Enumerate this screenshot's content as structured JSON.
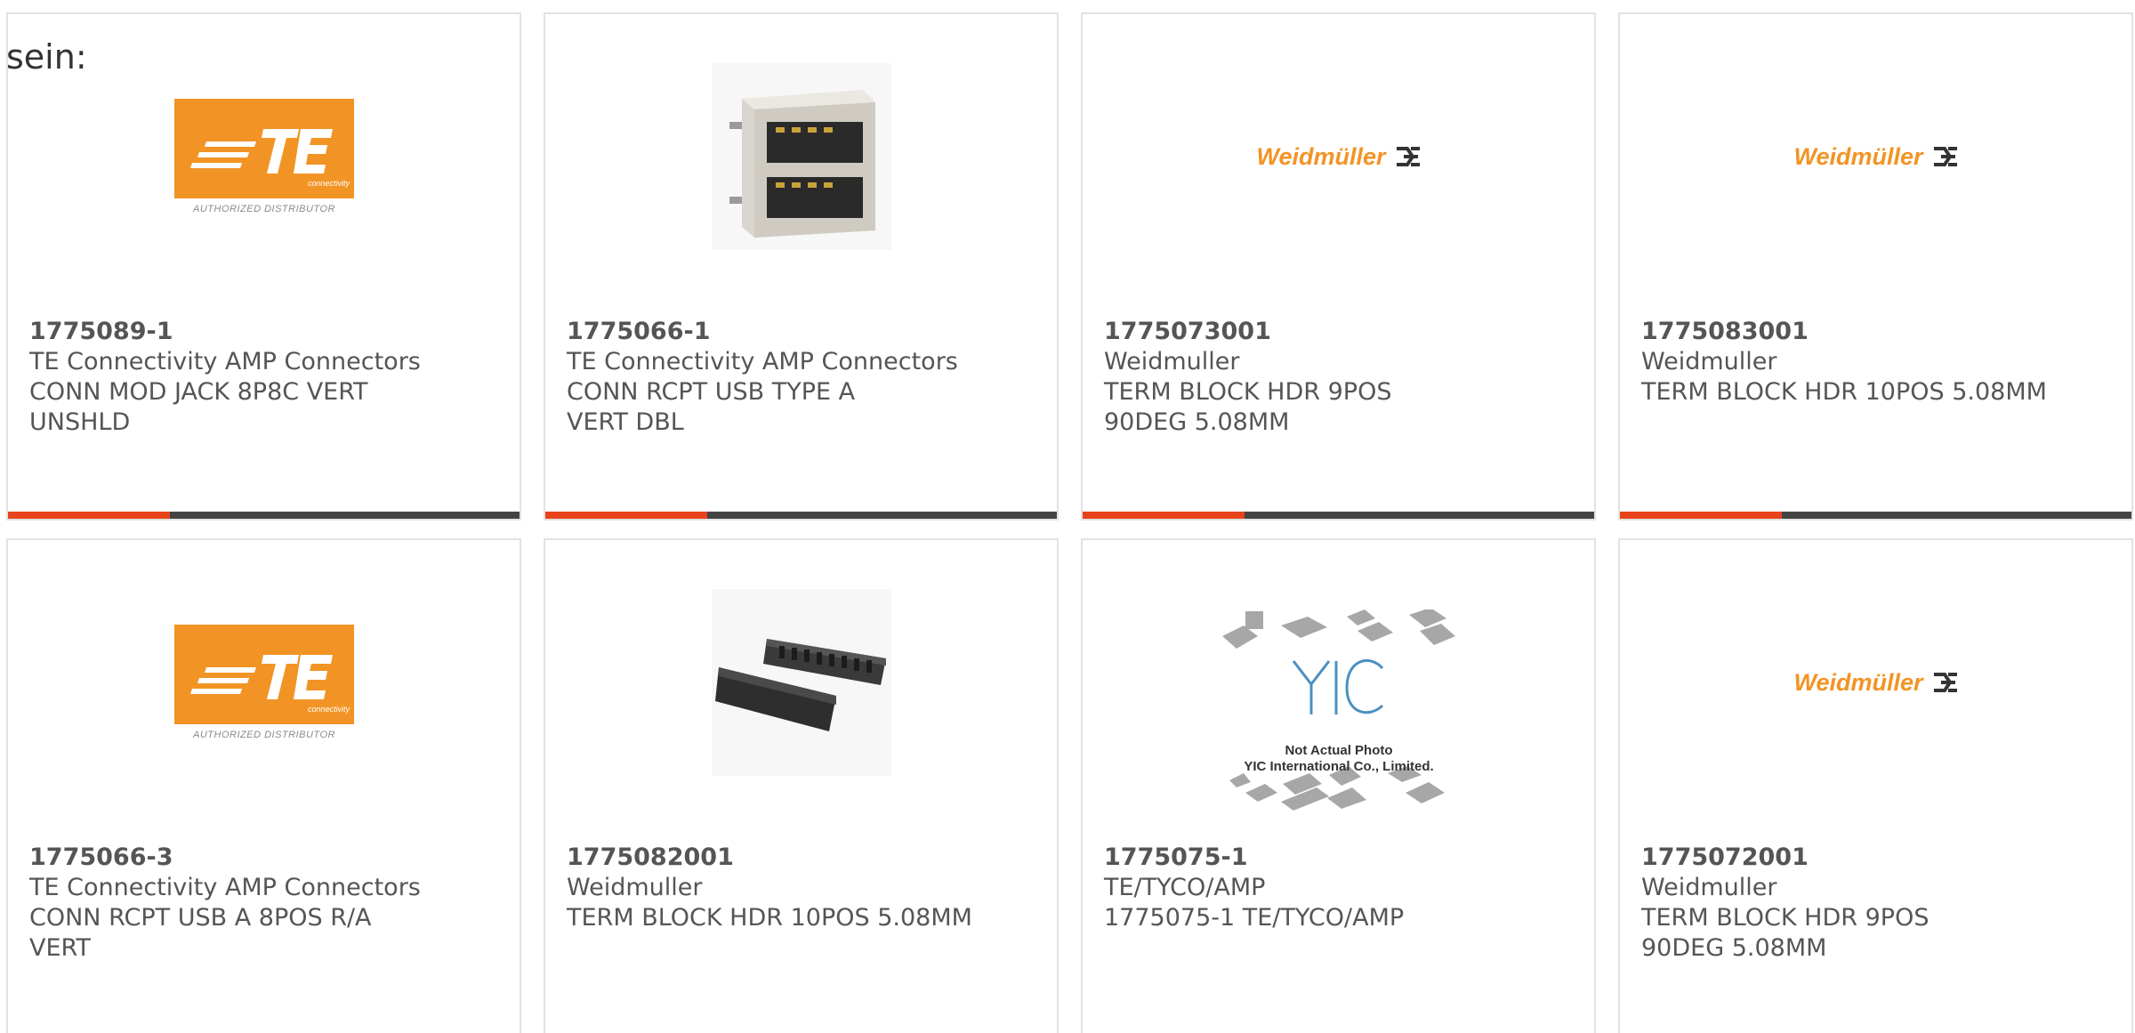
{
  "intro_text": "sein:",
  "colors": {
    "accent": "#e8431a",
    "bar": "#444444",
    "te_orange": "#f29425",
    "weidmuller_orange": "#f29425"
  },
  "products": [
    {
      "part_number": "1775089-1",
      "manufacturer": "TE Connectivity AMP Connectors",
      "description": "CONN MOD JACK 8P8C VERT UNSHLD",
      "image": "te-connectivity-logo",
      "logo_caption": "AUTHORIZED DISTRIBUTOR"
    },
    {
      "part_number": "1775066-1",
      "manufacturer": "TE Connectivity AMP Connectors",
      "description": "CONN RCPT USB TYPE A VERT DBL",
      "image": "usb-receptacle-photo"
    },
    {
      "part_number": "1775073001",
      "manufacturer": "Weidmuller",
      "description": "TERM BLOCK HDR 9POS 90DEG 5.08MM",
      "image": "weidmuller-logo",
      "logo_text": "Weidmüller"
    },
    {
      "part_number": "1775083001",
      "manufacturer": "Weidmuller",
      "description": "TERM BLOCK HDR 10POS 5.08MM",
      "image": "weidmuller-logo",
      "logo_text": "Weidmüller"
    },
    {
      "part_number": "1775066-3",
      "manufacturer": "TE Connectivity AMP Connectors",
      "description": "CONN RCPT USB A 8POS R/A VERT",
      "image": "te-connectivity-logo",
      "logo_caption": "AUTHORIZED DISTRIBUTOR"
    },
    {
      "part_number": "1775082001",
      "manufacturer": "Weidmuller",
      "description": "TERM BLOCK HDR 10POS 5.08MM",
      "image": "terminal-block-photo"
    },
    {
      "part_number": "1775075-1",
      "manufacturer": "TE/TYCO/AMP",
      "description": "1775075-1 TE/TYCO/AMP",
      "image": "yic-placeholder",
      "placeholder_line1": "Not Actual Photo",
      "placeholder_line2": "YIC International Co., Limited."
    },
    {
      "part_number": "1775072001",
      "manufacturer": "Weidmuller",
      "description": "TERM BLOCK HDR 9POS 90DEG 5.08MM",
      "image": "weidmuller-logo",
      "logo_text": "Weidmüller"
    }
  ]
}
